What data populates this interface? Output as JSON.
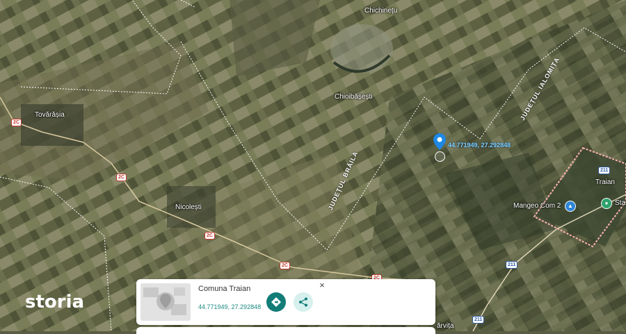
{
  "places": {
    "chichinetu": "Chichinețu",
    "chioibasesti": "Chioibășești",
    "tovarasia": "Tovărășia",
    "nicolesti": "Nicolești",
    "traian": "Traian",
    "mangeo": "Mangeo Com 2",
    "sta": "Sta",
    "bottom": "ărvița"
  },
  "counties": {
    "braila": "JUDEȚUL BRĂILA",
    "ialomita": "JUDEȚUL IALOMIȚA"
  },
  "roads": {
    "r2c": "2C",
    "r211": "211"
  },
  "marker": {
    "coords_label": "44.771949, 27.292848"
  },
  "card": {
    "title": "Comuna Traian",
    "coords": "44.771949, 27.292848",
    "close": "×"
  },
  "brand": {
    "logo": "storia"
  },
  "colors": {
    "accent": "#127c77",
    "marker": "#1e88e5"
  }
}
